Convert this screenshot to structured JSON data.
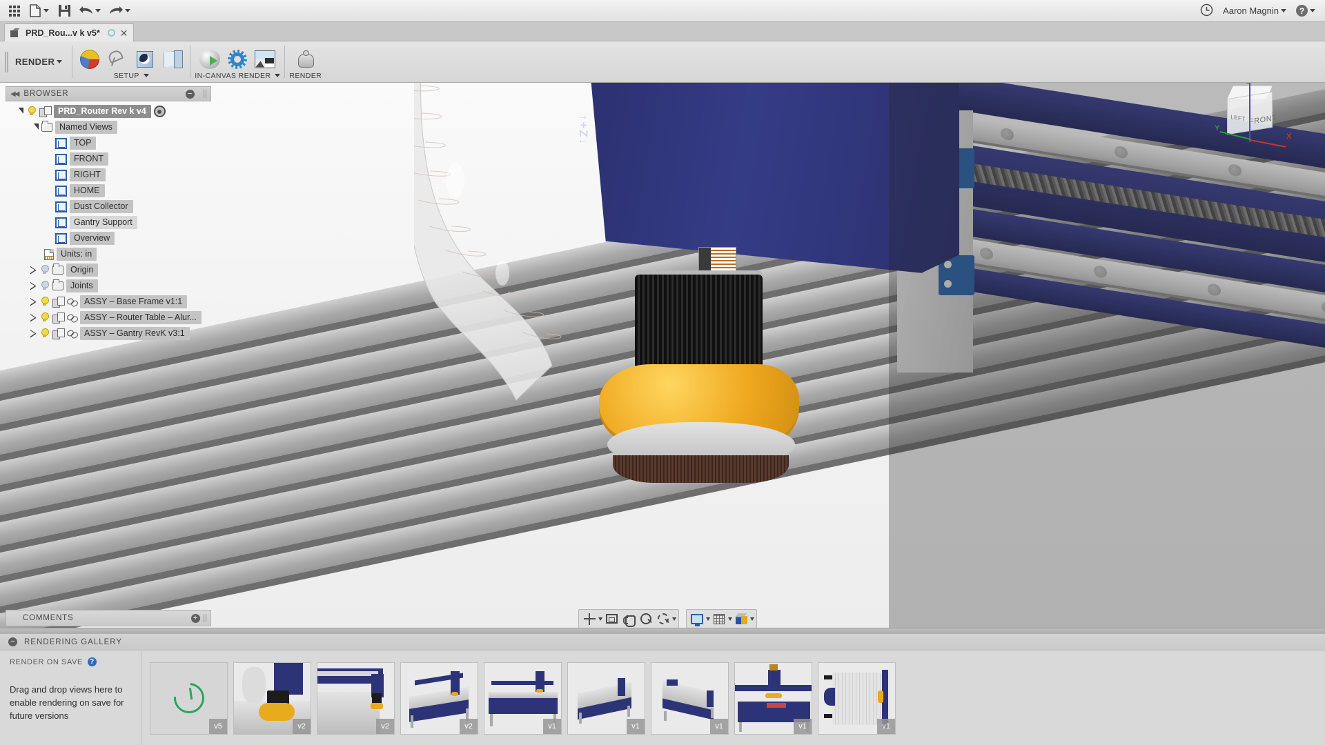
{
  "app": {
    "title_bar": {
      "apps_icon": "grid-apps-icon",
      "new_label": "new-file-icon",
      "save_label": "save-icon",
      "undo_label": "undo-icon",
      "redo_label": "redo-icon",
      "recent_icon": "clock-icon",
      "user_name": "Aaron Magnin",
      "help_icon": "help-icon"
    },
    "file_tab": {
      "title": "PRD_Rou...v k v5*",
      "sync_icon": "sync-circle-icon",
      "close_icon": "close-icon"
    },
    "ribbon": {
      "workspace": "RENDER",
      "groups": [
        {
          "label": "SETUP",
          "items": [
            {
              "name": "appearance",
              "icon": "appearance-icon"
            },
            {
              "name": "scene-settings",
              "icon": "scene-settings-icon"
            },
            {
              "name": "decal",
              "icon": "decal-icon"
            },
            {
              "name": "texture-map-controls",
              "icon": "texture-map-icon"
            }
          ]
        },
        {
          "label": "IN-CANVAS RENDER",
          "items": [
            {
              "name": "in-canvas-render",
              "icon": "in-canvas-render-icon"
            },
            {
              "name": "render-settings",
              "icon": "gear-icon"
            },
            {
              "name": "capture-image",
              "icon": "capture-image-icon"
            }
          ]
        },
        {
          "label": "RENDER",
          "items": [
            {
              "name": "render",
              "icon": "teapot-icon"
            }
          ]
        }
      ]
    }
  },
  "browser": {
    "header": "BROWSER",
    "collapse_icon": "collapse-left-icon",
    "minimize_icon": "minimize-icon",
    "root": {
      "label": "PRD_Router Rev k v4",
      "active_badge": "active-document-icon"
    },
    "named_views_label": "Named Views",
    "views": [
      "TOP",
      "FRONT",
      "RIGHT",
      "HOME",
      "Dust Collector",
      "Gantry Support",
      "Overview"
    ],
    "units": "Units: in",
    "origin": "Origin",
    "joints": "Joints",
    "components": [
      "ASSY – Base Frame v1:1",
      "ASSY – Router Table – Alur...",
      "ASSY – Gantry RevK v3:1"
    ]
  },
  "comments": {
    "label": "COMMENTS",
    "add_icon": "add-comment-icon"
  },
  "viewport": {
    "model_text": "↑+Z↓",
    "viewcube": {
      "front_face": "FRONT",
      "left_face": "LEFT",
      "axis_x": "X",
      "axis_y": "Y",
      "axis_z": "Z"
    }
  },
  "navbar": {
    "groups": [
      [
        {
          "name": "orbit",
          "icon": "orbit-icon",
          "has_caret": true
        },
        {
          "name": "look-at",
          "icon": "look-at-icon",
          "has_caret": false
        },
        {
          "name": "pan",
          "icon": "pan-hand-icon",
          "has_caret": false
        },
        {
          "name": "zoom",
          "icon": "zoom-icon",
          "has_caret": false
        },
        {
          "name": "zoom-window",
          "icon": "zoom-window-icon",
          "has_caret": true
        }
      ],
      [
        {
          "name": "display-settings",
          "icon": "display-settings-icon",
          "has_caret": true
        },
        {
          "name": "grid-and-snaps",
          "icon": "grid-icon",
          "has_caret": true
        },
        {
          "name": "viewports",
          "icon": "viewports-cube-icon",
          "has_caret": true
        }
      ]
    ]
  },
  "gallery": {
    "title": "RENDERING GALLERY",
    "collapse_icon": "minimize-icon",
    "render_on_save_label": "RENDER ON SAVE",
    "help_icon": "help-icon",
    "drop_hint": "Drag and drop views here to enable rendering on save for future versions",
    "thumbnails": [
      {
        "version": "v5",
        "state": "pending",
        "subject": "in-progress-render"
      },
      {
        "version": "v2",
        "state": "done",
        "subject": "dust-shoe-closeup"
      },
      {
        "version": "v2",
        "state": "done",
        "subject": "gantry-rail-closeup"
      },
      {
        "version": "v2",
        "state": "done",
        "subject": "router-table-iso"
      },
      {
        "version": "v1",
        "state": "done",
        "subject": "router-table-front"
      },
      {
        "version": "v1",
        "state": "done",
        "subject": "router-table-side"
      },
      {
        "version": "v1",
        "state": "done",
        "subject": "router-table-angled"
      },
      {
        "version": "v1",
        "state": "done",
        "subject": "router-table-front-panel"
      },
      {
        "version": "v1",
        "state": "done",
        "subject": "router-table-top"
      }
    ]
  },
  "colors": {
    "machine_blue": "#2c3477",
    "dust_shoe_yellow": "#e8ab1e",
    "accent_green": "#26a65b",
    "ui_chrome": "#d4d4d4"
  }
}
